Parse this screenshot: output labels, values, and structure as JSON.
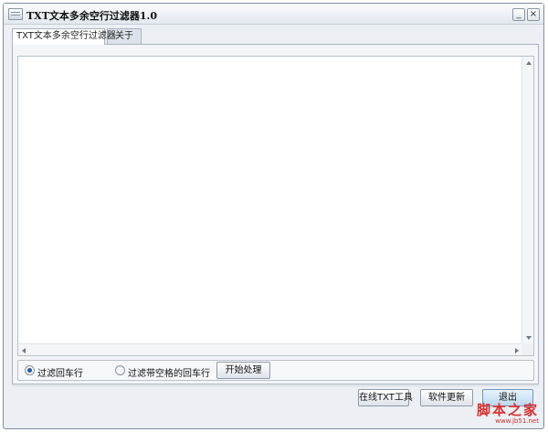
{
  "window": {
    "title": "TXT文本多余空行过滤器1.0",
    "minimize_glyph": "_",
    "close_glyph": "×"
  },
  "tabs": [
    {
      "label": "TXT文本多余空行过滤器",
      "active": true
    },
    {
      "label": "关于",
      "active": false
    }
  ],
  "editor": {
    "value": "",
    "placeholder": ""
  },
  "options": {
    "radio_1": {
      "label": "过滤回车行",
      "checked": true
    },
    "radio_2": {
      "label": "过滤带空格的回车行",
      "checked": false
    },
    "start_button": "开始处理"
  },
  "footer": {
    "online_tools": "在线TXT工具",
    "software_update": "软件更新",
    "exit": "退出"
  },
  "watermark": {
    "main": "脚本之家",
    "sub": "www.jb51.net"
  },
  "colors": {
    "accent": "#2a5aa5",
    "watermark": "#d92e2e",
    "border": "#7e8fa3"
  }
}
